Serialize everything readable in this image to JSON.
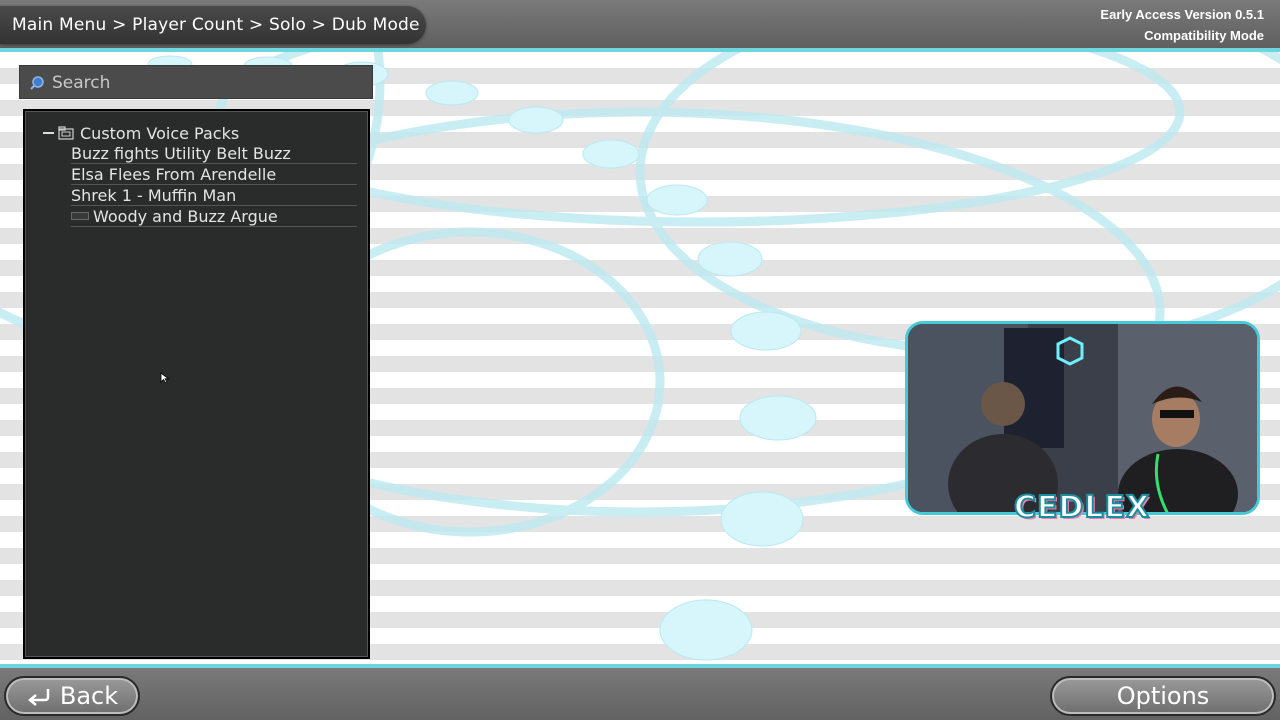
{
  "header": {
    "breadcrumb": "Main Menu > Player Count > Solo > Dub Mode",
    "version_line1": "Early Access Version 0.5.1",
    "version_line2": "Compatibility Mode"
  },
  "search": {
    "placeholder": "Search",
    "value": ""
  },
  "tree": {
    "root_label": "Custom Voice Packs",
    "items": [
      {
        "label": "Buzz fights Utility Belt Buzz"
      },
      {
        "label": "Elsa Flees From Arendelle"
      },
      {
        "label": "Shrek 1 - Muffin Man"
      },
      {
        "label": "Woody and Buzz Argue"
      }
    ]
  },
  "webcam": {
    "label": "CEDLEX"
  },
  "footer": {
    "back_label": "Back",
    "options_label": "Options"
  },
  "colors": {
    "accent": "#6fd6e0",
    "panel": "#2a2b2b",
    "bar": "#6a6a6a"
  }
}
